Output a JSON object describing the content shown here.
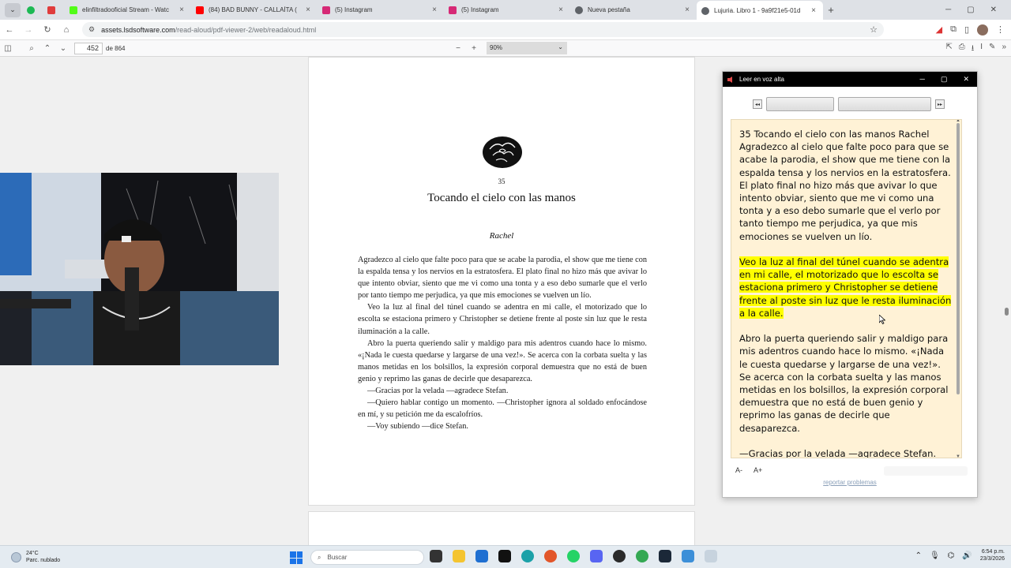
{
  "tabs": [
    {
      "title": "",
      "color": "#1db954"
    },
    {
      "title": "",
      "color": "#e03c3c"
    },
    {
      "title": "elinfiltradooficial Stream - Watc",
      "color": "#53fc18"
    },
    {
      "title": "(84) BAD BUNNY - CALLAÍTA (",
      "color": "#ff0000"
    },
    {
      "title": "(5) Instagram",
      "color": "#d62976"
    },
    {
      "title": "(5) Instagram",
      "color": "#d62976"
    },
    {
      "title": "Nueva pestaña",
      "color": "#5f6368"
    },
    {
      "title": "Lujuria. Libro 1 - 9a9f21e5-01d",
      "color": "#5f6368"
    }
  ],
  "address": {
    "host": "assets.lsdsoftware.com",
    "path": "/read-aloud/pdf-viewer-2/web/readaloud.html"
  },
  "pdf": {
    "page": "452",
    "page_count": "de 864",
    "zoom": "90%"
  },
  "chapter": {
    "number": "35",
    "title": "Tocando el cielo con las manos",
    "author": "Rachel",
    "paragraphs": [
      "Agradezco al cielo que falte poco para que se acabe la parodia, el show que me tiene con la espalda tensa y los nervios en la estratosfera. El plato final no hizo más que avivar lo que intento obviar, siento que me vi como una tonta y a eso debo sumarle que el verlo por tanto tiempo me perjudica, ya que mis emociones se vuelven un lío.",
      "Veo la luz al final del túnel cuando se adentra en mi calle, el motorizado que lo escolta se estaciona primero y Christopher se detiene frente al poste sin luz que le resta iluminación a la calle.",
      "Abro la puerta queriendo salir y maldigo para mis adentros cuando hace lo mismo. «¡Nada le cuesta quedarse y largarse de una vez!». Se acerca con la corbata suelta y las manos metidas en los bolsillos, la expresión corporal demuestra que no está de buen genio y reprimo las ganas de decirle que desaparezca.",
      "—Gracias por la velada —agradece Stefan.",
      "—Quiero hablar contigo un momento. —Christopher ignora al soldado enfocándose en mí, y su petición me da escalofríos.",
      "—Voy subiendo —dice Stefan."
    ]
  },
  "read_aloud": {
    "window_title": "Leer en voz alta",
    "paragraphs": [
      {
        "text": "35 Tocando el cielo con las manos Rachel Agradezco al cielo que falte poco para que se acabe la parodia, el show que me tiene con la espalda tensa y los nervios en la estratosfera. El plato final no hizo más que avivar lo que intento obviar, siento que me vi como una tonta y a eso debo sumarle que el verlo por tanto tiempo me perjudica, ya que mis emociones se vuelven un lío."
      },
      {
        "text": "Veo la luz al final del túnel cuando se adentra en mi calle, el motorizado que lo escolta se estaciona primero y Christopher se detiene frente al poste sin luz que le resta iluminación a la calle.",
        "highlighted": true
      },
      {
        "text": "Abro la puerta queriendo salir y maldigo para mis adentros cuando hace lo mismo. «¡Nada le cuesta quedarse y largarse de una vez!». Se acerca con la corbata suelta y las manos metidas en los bolsillos, la expresión corporal demuestra que no está de buen genio y reprimo las ganas de decirle que desaparezca."
      },
      {
        "text": "—Gracias por la velada —agradece Stefan."
      }
    ],
    "font_decrease": "A-",
    "font_increase": "A+",
    "report_link": "reportar problemas",
    "highlight_color": "#ffff00",
    "panel_color": "#fff2d6"
  },
  "taskbar": {
    "temperature": "24°C",
    "weather": "Parc. nublado",
    "search_placeholder": "Buscar",
    "time": "6:54 p.m.",
    "date": "23/3/2026"
  }
}
